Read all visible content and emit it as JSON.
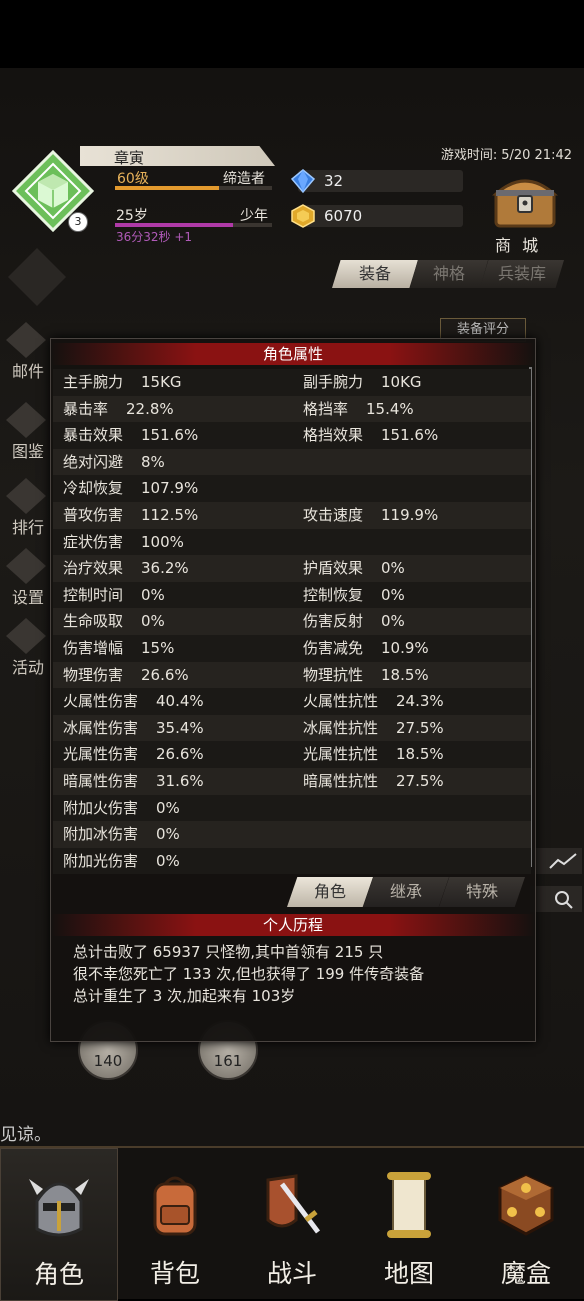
{
  "status": {
    "game_time_label": "游戏时间:",
    "game_time_value": "5/20 21:42"
  },
  "character": {
    "name": "章寅",
    "level": "60级",
    "title": "缔造者",
    "exp_progress": 0.66,
    "age": "25岁",
    "age_stage": "少年",
    "age_progress": 0.75,
    "timer": "36分32秒 +1",
    "avatar_rank": "3"
  },
  "currency": {
    "gems": "32",
    "gold": "6070"
  },
  "shop_label": "商 城",
  "right_tabs": [
    "装备",
    "神格",
    "兵装库"
  ],
  "equip_score_label": "装备评分",
  "side_nav": [
    "邮件",
    "图鉴",
    "排行",
    "设置",
    "活动"
  ],
  "attributes": {
    "title": "角色属性",
    "rows": [
      {
        "l_name": "主手腕力",
        "l_val": "15KG",
        "r_name": "副手腕力",
        "r_val": "10KG"
      },
      {
        "l_name": "暴击率",
        "l_val": "22.8%",
        "r_name": "格挡率",
        "r_val": "15.4%"
      },
      {
        "l_name": "暴击效果",
        "l_val": "151.6%",
        "r_name": "格挡效果",
        "r_val": "151.6%"
      },
      {
        "l_name": "绝对闪避",
        "l_val": "8%",
        "r_name": "",
        "r_val": ""
      },
      {
        "l_name": "冷却恢复",
        "l_val": "107.9%",
        "r_name": "",
        "r_val": ""
      },
      {
        "l_name": "普攻伤害",
        "l_val": "112.5%",
        "r_name": "攻击速度",
        "r_val": "119.9%"
      },
      {
        "l_name": "症状伤害",
        "l_val": "100%",
        "r_name": "",
        "r_val": ""
      },
      {
        "l_name": "治疗效果",
        "l_val": "36.2%",
        "r_name": "护盾效果",
        "r_val": "0%"
      },
      {
        "l_name": "控制时间",
        "l_val": "0%",
        "r_name": "控制恢复",
        "r_val": "0%"
      },
      {
        "l_name": "生命吸取",
        "l_val": "0%",
        "r_name": "伤害反射",
        "r_val": "0%"
      },
      {
        "l_name": "伤害增幅",
        "l_val": "15%",
        "r_name": "伤害减免",
        "r_val": "10.9%"
      },
      {
        "l_name": "物理伤害",
        "l_val": "26.6%",
        "r_name": "物理抗性",
        "r_val": "18.5%"
      },
      {
        "l_name": "火属性伤害",
        "l_val": "40.4%",
        "r_name": "火属性抗性",
        "r_val": "24.3%"
      },
      {
        "l_name": "冰属性伤害",
        "l_val": "35.4%",
        "r_name": "冰属性抗性",
        "r_val": "27.5%"
      },
      {
        "l_name": "光属性伤害",
        "l_val": "26.6%",
        "r_name": "光属性抗性",
        "r_val": "18.5%"
      },
      {
        "l_name": "暗属性伤害",
        "l_val": "31.6%",
        "r_name": "暗属性抗性",
        "r_val": "27.5%"
      },
      {
        "l_name": "附加火伤害",
        "l_val": "0%",
        "r_name": "",
        "r_val": ""
      },
      {
        "l_name": "附加冰伤害",
        "l_val": "0%",
        "r_name": "",
        "r_val": ""
      },
      {
        "l_name": "附加光伤害",
        "l_val": "0%",
        "r_name": "",
        "r_val": ""
      }
    ],
    "tabs": [
      "角色",
      "继承",
      "特殊"
    ]
  },
  "history": {
    "title": "个人历程",
    "lines": [
      "总计击败了 65937 只怪物,其中首领有 215 只",
      "很不幸您死亡了 133 次,但也获得了 199 件传奇装备",
      "总计重生了 3 次,加起来有 103岁"
    ]
  },
  "background": {
    "dial_left": "140",
    "dial_right": "161",
    "sorry_text": "见谅。"
  },
  "bottom_nav": [
    "角色",
    "背包",
    "战斗",
    "地图",
    "魔盒"
  ],
  "colors": {
    "accent_red": "#8a1212",
    "gold": "#e39a2e",
    "purple": "#b03aa8",
    "avatar_green": "#4aa84a"
  }
}
